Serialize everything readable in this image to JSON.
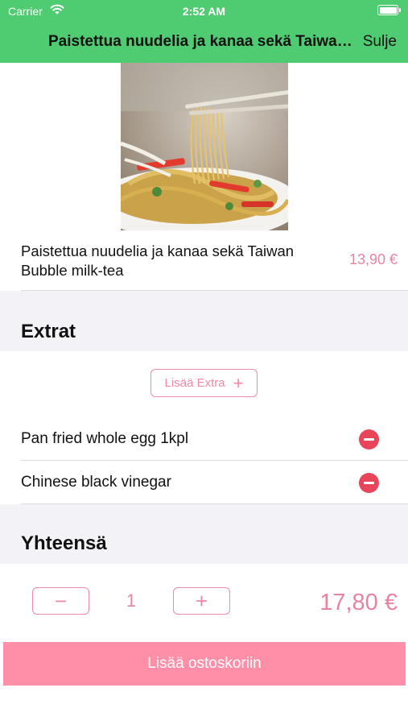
{
  "status_bar": {
    "carrier": "Carrier",
    "time": "2:52 AM"
  },
  "nav": {
    "title": "Paistettua nuudelia ja kanaa sekä Taiwan Bubble milk-tea",
    "close_label": "Sulje"
  },
  "product": {
    "image_icon": "noodle-dish-photo",
    "name": "Paistettua nuudelia ja kanaa sekä Taiwan Bubble milk-tea",
    "price": "13,90 €"
  },
  "extras": {
    "header": "Extrat",
    "add_label": "Lisää Extra",
    "items": [
      {
        "label": "Pan fried whole egg 1kpl"
      },
      {
        "label": "Chinese black vinegar"
      }
    ]
  },
  "total": {
    "header": "Yhteensä",
    "decrement_symbol": "−",
    "quantity": "1",
    "increment_symbol": "+",
    "price": "17,80 €",
    "cart_button_label": "Lisää ostoskoriin"
  },
  "colors": {
    "nav_green": "#4fcb71",
    "accent_pink": "#f08aa6",
    "button_pink": "#ff8fa8",
    "remove_red": "#e8445a"
  }
}
